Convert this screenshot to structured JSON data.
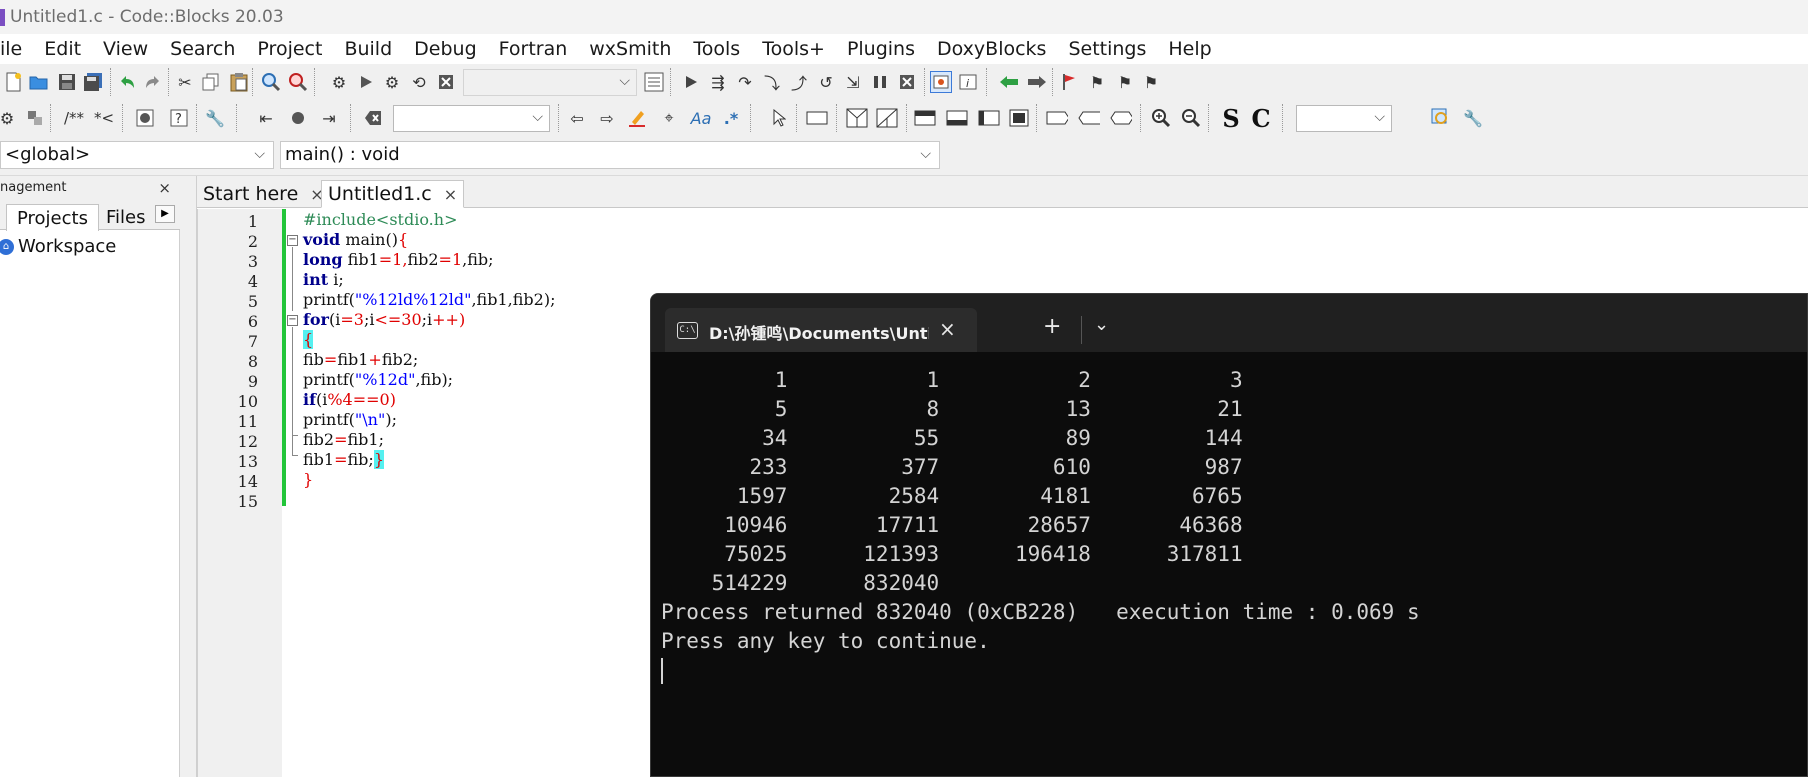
{
  "window": {
    "title": "Untitled1.c - Code::Blocks 20.03"
  },
  "menu": [
    "ile",
    "Edit",
    "View",
    "Search",
    "Project",
    "Build",
    "Debug",
    "Fortran",
    "wxSmith",
    "Tools",
    "Tools+",
    "Plugins",
    "DoxyBlocks",
    "Settings",
    "Help"
  ],
  "toolbar": {
    "doxy_comment": "/**",
    "doxy_inline": "*<",
    "code_completion_s": "S",
    "code_completion_c": "C"
  },
  "scope": {
    "global_value": "<global>",
    "function_value": "main() : void"
  },
  "management": {
    "header": "nagement",
    "close": "×",
    "tabs": [
      "Projects",
      "Files"
    ],
    "tree": {
      "workspace": "Workspace"
    }
  },
  "editor": {
    "tabs": [
      {
        "label": "Start here",
        "close": "×"
      },
      {
        "label": "Untitled1.c",
        "close": "×"
      }
    ],
    "line_numbers": [
      "1",
      "2",
      "3",
      "4",
      "5",
      "6",
      "7",
      "8",
      "9",
      "10",
      "11",
      "12",
      "13",
      "14",
      "15"
    ],
    "code": {
      "l1": "#include<stdio.h>",
      "l2_kw": "void",
      "l2_rest": " main()",
      "l2_brace": "{",
      "l3_kw": "long",
      "l3_a": " fib1",
      "l3_b": "=",
      "l3_c": "1",
      "l3_d": ",",
      "l3_e": "fib2",
      "l3_f": "=",
      "l3_g": "1",
      "l3_h": ",fib;",
      "l4_kw": "int",
      "l4_rest": " i;",
      "l5_a": "printf(",
      "l5_str": "\"%12ld%12ld\"",
      "l5_rest": ",fib1,fib2);",
      "l6_kw": "for",
      "l6_a": "(i",
      "l6_b": "=",
      "l6_c": "3",
      "l6_d": ";i",
      "l6_e": "<=",
      "l6_f": "30",
      "l6_g": ";i",
      "l6_h": "++",
      "l6_i": ")",
      "l7": "{",
      "l8_a": "fib",
      "l8_b": "=",
      "l8_c": "fib1",
      "l8_d": "+",
      "l8_e": "fib2;",
      "l9_a": "printf(",
      "l9_str": "\"%12d\"",
      "l9_rest": ",fib);",
      "l10_kw": "if",
      "l10_a": "(i",
      "l10_b": "%",
      "l10_c": "4",
      "l10_d": "==",
      "l10_e": "0",
      "l10_f": ")",
      "l11_a": "printf(",
      "l11_str": "\"\\n\"",
      "l11_rest": ");",
      "l12_a": "fib2",
      "l12_b": "=",
      "l12_c": "fib1;",
      "l13_a": "fib1",
      "l13_b": "=",
      "l13_c": "fib;",
      "l13_brace": "}",
      "l14": "}"
    }
  },
  "terminal": {
    "tab_title": "D:\\孙锺鸣\\Documents\\Untitle",
    "tab_close": "×",
    "add": "+",
    "dropdown": "⌄",
    "output": [
      "         1           1           2           3",
      "         5           8          13          21",
      "        34          55          89         144",
      "       233         377         610         987",
      "      1597        2584        4181        6765",
      "     10946       17711       28657       46368",
      "     75025      121393      196418      317811",
      "    514229      832040",
      "Process returned 832040 (0xCB228)   execution time : 0.069 s",
      "Press any key to continue."
    ]
  }
}
